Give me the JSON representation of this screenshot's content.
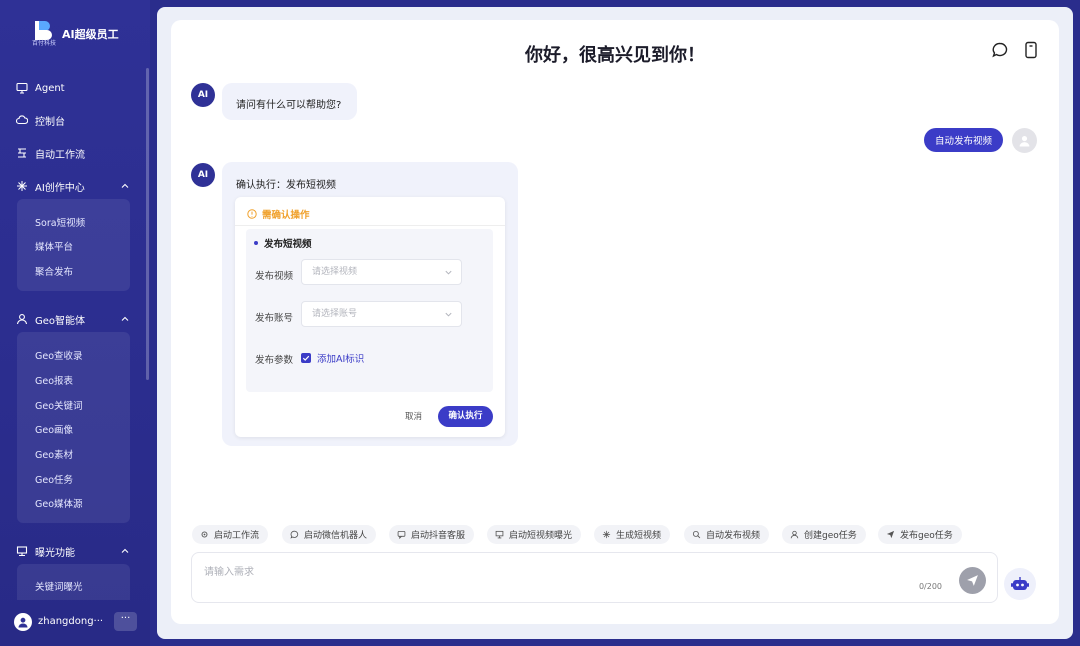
{
  "brand": {
    "title": "AI超级员工",
    "subtitle": "百付科技"
  },
  "sidebar": {
    "items": [
      {
        "label": "Agent",
        "icon": "monitor-icon"
      },
      {
        "label": "控制台",
        "icon": "cloud-icon"
      },
      {
        "label": "自动工作流",
        "icon": "workflow-icon"
      },
      {
        "label": "AI创作中心",
        "icon": "sparkle-icon"
      },
      {
        "label": "Geo智能体",
        "icon": "user-icon"
      },
      {
        "label": "曝光功能",
        "icon": "store-icon"
      }
    ],
    "ai_center_sub": [
      "Sora短视频",
      "媒体平台",
      "聚合发布"
    ],
    "geo_sub": [
      "Geo查收录",
      "Geo报表",
      "Geo关键词",
      "Geo画像",
      "Geo素材",
      "Geo任务",
      "Geo媒体源"
    ],
    "exposure_sub": [
      "关键词曝光"
    ],
    "user": {
      "name": "zhangdong···",
      "more": "···"
    }
  },
  "header": {
    "title": "你好，很高兴见到你！"
  },
  "chat": {
    "ai_avatar": "AI",
    "greeting": "请问有什么可以帮助您?",
    "user_message": "自动发布视频",
    "confirm_title": "确认执行：发布短视频",
    "confirm": {
      "warning": "需确认操作",
      "section_title": "发布短视频",
      "video_label": "发布视频",
      "video_placeholder": "请选择视频",
      "account_label": "发布账号",
      "account_placeholder": "请选择账号",
      "params_label": "发布参数",
      "checkbox_label": "添加AI标识",
      "cancel": "取消",
      "submit": "确认执行"
    }
  },
  "quick_actions": [
    {
      "label": "启动工作流",
      "icon": "gear-icon"
    },
    {
      "label": "启动微信机器人",
      "icon": "chat-icon"
    },
    {
      "label": "启动抖音客服",
      "icon": "message-icon"
    },
    {
      "label": "启动短视频曝光",
      "icon": "store-icon"
    },
    {
      "label": "生成短视频",
      "icon": "sparkle-icon"
    },
    {
      "label": "自动发布视频",
      "icon": "search-icon"
    },
    {
      "label": "创建geo任务",
      "icon": "user-icon"
    },
    {
      "label": "发布geo任务",
      "icon": "send-icon"
    }
  ],
  "input": {
    "placeholder": "请输入需求",
    "counter": "0/200"
  },
  "colors": {
    "sidebar": "#2f3196",
    "accent": "#3b3cc7",
    "warning": "#f0a12c"
  }
}
